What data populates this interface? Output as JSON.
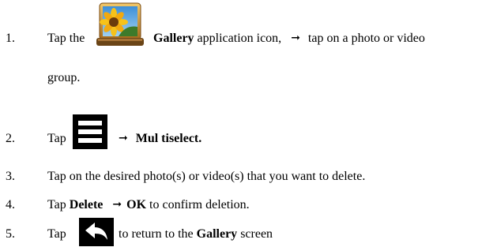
{
  "steps": [
    {
      "number": "1.",
      "text_a": "Tap the",
      "bold_a": "Gallery",
      "text_b": "application icon,",
      "text_c": "tap on a photo or video",
      "line2": "group."
    },
    {
      "number": "2.",
      "text_a": "Tap",
      "bold_a": "Mul tiselect."
    },
    {
      "number": "3.",
      "text_a": "Tap on the desired photo(s) or video(s) that you want to delete."
    },
    {
      "number": "4.",
      "text_a": "Tap",
      "bold_a": "Delete",
      "bold_b": "OK",
      "text_b": "to confirm deletion."
    },
    {
      "number": "5.",
      "text_a": "Tap",
      "text_b": "to return to the",
      "bold_a": "Gallery",
      "text_c": "screen"
    }
  ],
  "arrow_glyph": "➞",
  "icons": {
    "gallery": "gallery-app-icon",
    "menu": "menu-icon",
    "back": "back-icon"
  }
}
